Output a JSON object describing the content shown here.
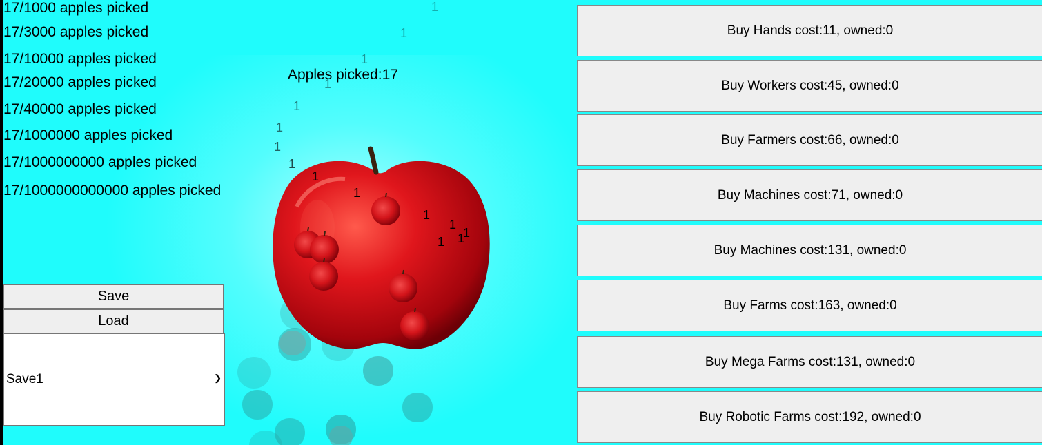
{
  "goals": [
    "17/1000 apples picked",
    "17/3000 apples picked",
    "17/10000 apples picked",
    "17/20000 apples picked",
    "17/40000 apples picked",
    "17/1000000 apples picked",
    "17/1000000000 apples picked",
    "17/1000000000000 apples picked"
  ],
  "counter": {
    "label": "Apples picked:17"
  },
  "save_panel": {
    "save_label": "Save",
    "load_label": "Load",
    "selected_slot": "Save1"
  },
  "shop": [
    "Buy Hands cost:11, owned:0",
    "Buy Workers cost:45, owned:0",
    "Buy Farmers cost:66, owned:0",
    "Buy Machines cost:71, owned:0",
    "Buy Machines cost:131, owned:0",
    "Buy Farms cost:163, owned:0",
    "Buy Mega Farms cost:131, owned:0",
    "Buy Robotic Farms cost:192, owned:0"
  ],
  "floating_text": "1",
  "colors": {
    "background": "#1ffcfc",
    "apple_red": "#d3141a",
    "button_bg": "#efefef"
  },
  "icons": {
    "apple": "apple-icon",
    "chevron": "chevron-down-icon"
  }
}
